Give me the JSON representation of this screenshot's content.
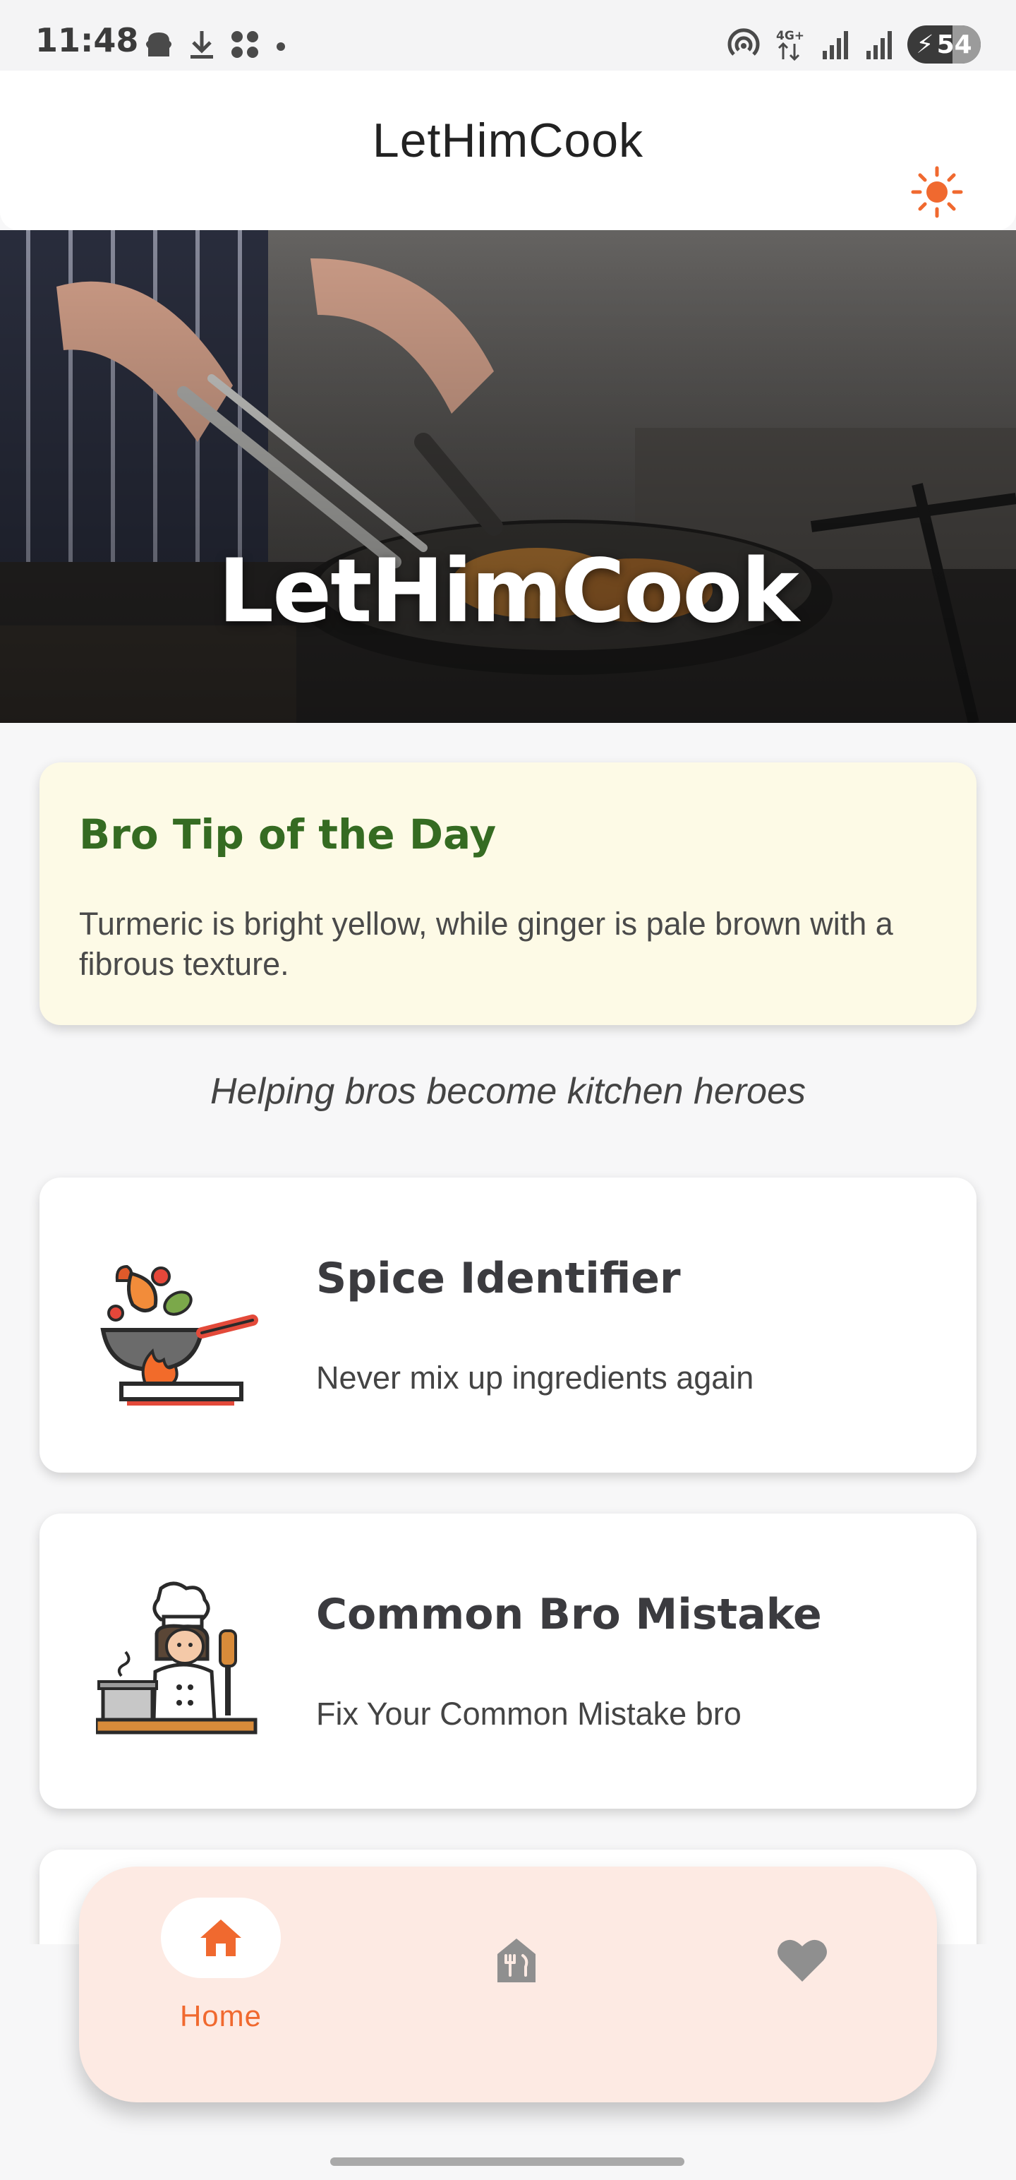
{
  "status_bar": {
    "time": "11:48",
    "battery": "54",
    "network": "4G+"
  },
  "app_bar": {
    "title": "LetHimCook",
    "theme_icon": "sun-icon"
  },
  "hero": {
    "title": "LetHimCook"
  },
  "tip": {
    "title": "Bro Tip of the Day",
    "text": "Turmeric is bright yellow, while ginger is pale brown with a fibrous texture."
  },
  "tagline": "Helping bros become kitchen heroes",
  "features": [
    {
      "title": "Spice Identifier",
      "subtitle": "Never mix up ingredients again",
      "icon": "wok-cooking-icon"
    },
    {
      "title": "Common Bro Mistake",
      "subtitle": "Fix Your Common Mistake bro",
      "icon": "chef-icon"
    }
  ],
  "bottom_nav": {
    "items": [
      {
        "label": "Home",
        "icon": "home-icon",
        "active": true
      },
      {
        "label": "",
        "icon": "restaurant-icon",
        "active": false
      },
      {
        "label": "",
        "icon": "heart-icon",
        "active": false
      }
    ]
  },
  "colors": {
    "accent": "#f0692f",
    "tip_title": "#356b22",
    "tip_background": "#fdfae6",
    "nav_background": "#fdeae3"
  }
}
